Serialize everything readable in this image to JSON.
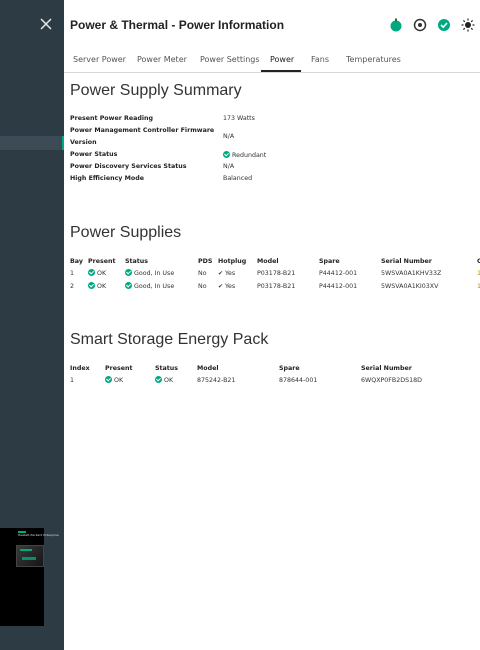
{
  "header": {
    "title": "Power & Thermal - Power Information",
    "icons": [
      "health-icon",
      "uid-icon",
      "ok-icon",
      "sun-icon"
    ]
  },
  "tabs": [
    "Server Power",
    "Power Meter",
    "Power Settings",
    "Power",
    "Fans",
    "Temperatures"
  ],
  "active_tab": "Power",
  "summary": {
    "title": "Power Supply Summary",
    "rows": [
      {
        "label": "Present Power Reading",
        "value": "173 Watts"
      },
      {
        "label": "Power Management Controller Firmware",
        "label2": "Version",
        "value": "N/A"
      },
      {
        "label": "Power Status",
        "value": "Redundant"
      },
      {
        "label": "Power Discovery Services Status",
        "value": "N/A"
      },
      {
        "label": "High Efficiency Mode",
        "value": "Balanced"
      }
    ]
  },
  "supplies": {
    "title": "Power Supplies",
    "columns": [
      "Bay",
      "Present",
      "Status",
      "PDS",
      "Hotplug",
      "Model",
      "Spare",
      "Serial Number"
    ],
    "rows": [
      {
        "bay": "1",
        "present": "OK",
        "status": "Good, In Use",
        "pds": "No",
        "hotplug": "Yes",
        "model": "P03178-B21",
        "spare": "P44412-001",
        "serial": "5WSVA0A1KHV33Z"
      },
      {
        "bay": "2",
        "present": "OK",
        "status": "Good, In Use",
        "pds": "No",
        "hotplug": "Yes",
        "model": "P03178-B21",
        "spare": "P44412-001",
        "serial": "5WSVA0A1KI03XV"
      }
    ]
  },
  "energy": {
    "title": "Smart Storage Energy Pack",
    "columns": [
      "Index",
      "Present",
      "Status",
      "Model",
      "Spare",
      "Serial Number"
    ],
    "rows": [
      {
        "index": "1",
        "present": "OK",
        "status": "OK",
        "model": "875242-B21",
        "spare": "878644-001",
        "serial": "6WQXP0FB2DS18D"
      }
    ]
  },
  "thumbnail": {
    "brand": "Hewlett Packard Enterprise"
  },
  "colors": {
    "accent": "#01a982",
    "sidebar": "#2d3b45"
  }
}
